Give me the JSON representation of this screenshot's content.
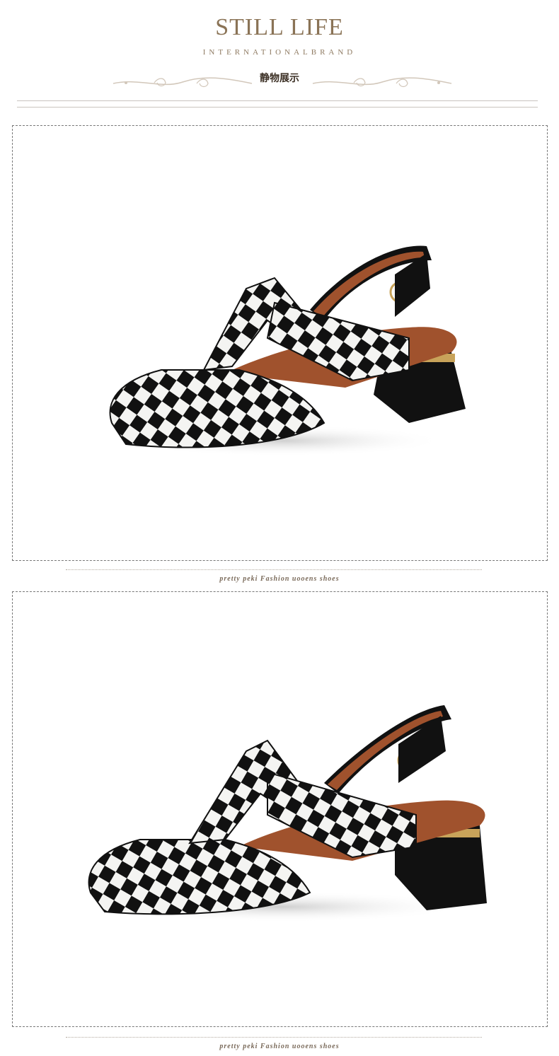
{
  "header": {
    "title": "STILL LIFE",
    "subtitle": "INTERNATIONALBRAND",
    "cn_title": "静物展示"
  },
  "photos": [
    {
      "icon": "checkered-slingback-shoe",
      "caption": "pretty peki Fashion uooens shoes"
    },
    {
      "icon": "checkered-slingback-shoe",
      "caption": "pretty peki Fashion uooens shoes"
    }
  ],
  "colors": {
    "brand_text": "#8a7356",
    "leather_brown": "#a0522d",
    "patent_black": "#111111",
    "checker_white": "#f4f4f2",
    "hardware_gold": "#c8a35a"
  }
}
